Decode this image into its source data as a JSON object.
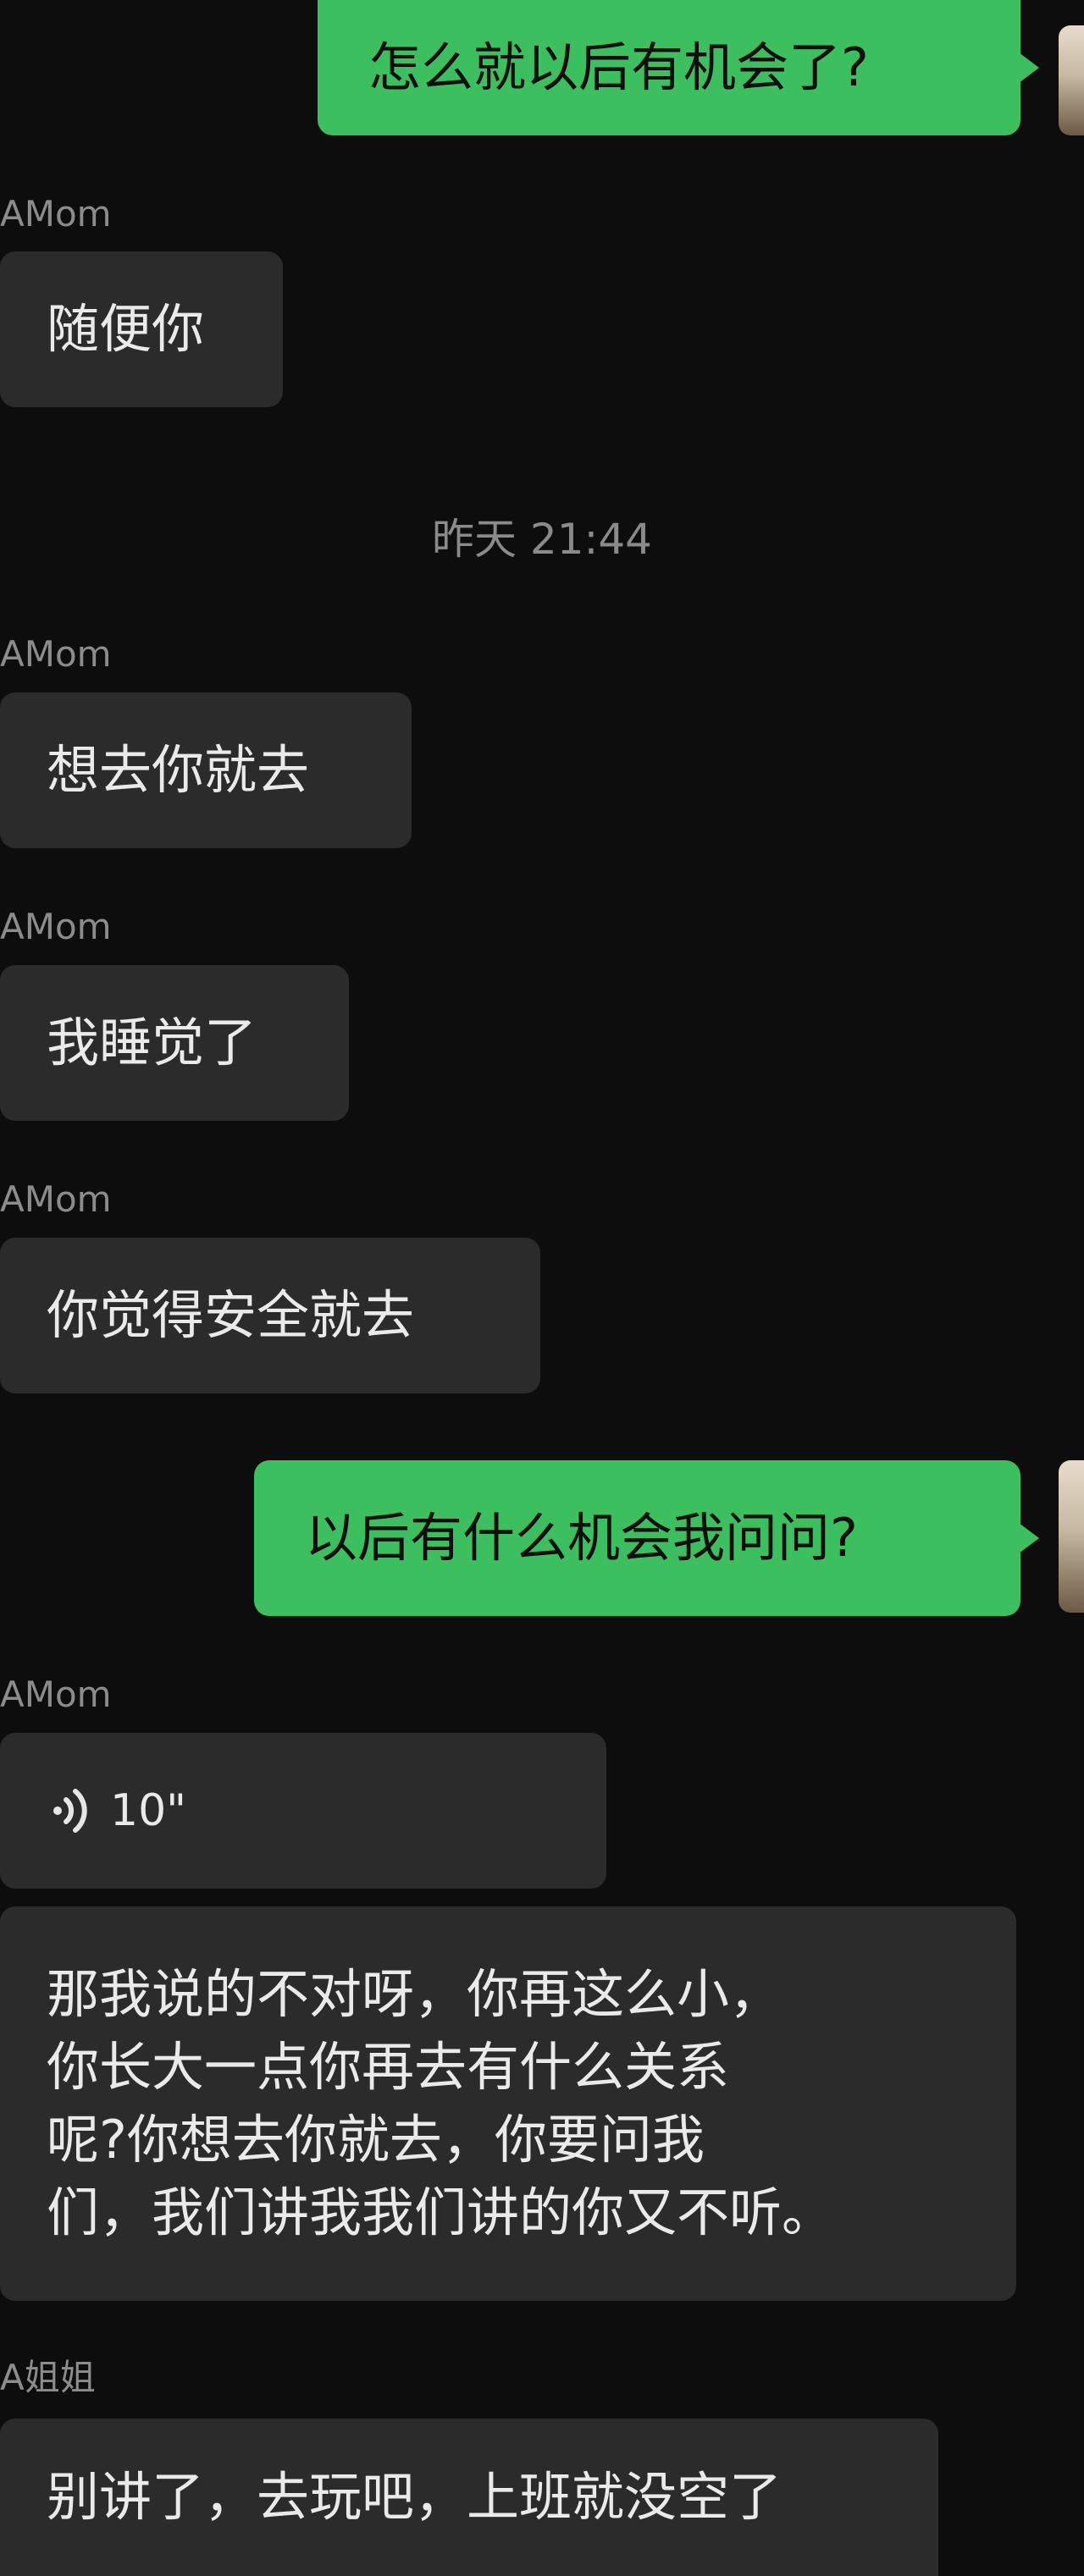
{
  "messages": {
    "m1_out": "怎么就以后有机会了?",
    "m2_sender": "AMom",
    "m2_text": "随便你",
    "timestamp": "昨天 21:44",
    "m3_sender": "AMom",
    "m3_text": "想去你就去",
    "m4_sender": "AMom",
    "m4_text": "我睡觉了",
    "m5_sender": "AMom",
    "m5_text": "你觉得安全就去",
    "m6_out": "以后有什么机会我问问?",
    "m7_sender": "AMom",
    "m7_voice_duration": "10\"",
    "m8_lines": [
      "那我说的不对呀，你再这么小，",
      "你长大一点你再去有什么关系",
      "呢?你想去你就去，你要问我",
      "们，我们讲我我们讲的你又不听。"
    ],
    "m9_sender": "A姐姐",
    "m9_text": "别讲了，去玩吧，上班就没空了"
  },
  "colors": {
    "background": "#0d0d0d",
    "incoming_bubble": "#2b2b2b",
    "outgoing_bubble": "#3cbf5f",
    "sender_text": "#8c8c8c"
  },
  "icons": {
    "voice": "voice-wave-icon"
  }
}
